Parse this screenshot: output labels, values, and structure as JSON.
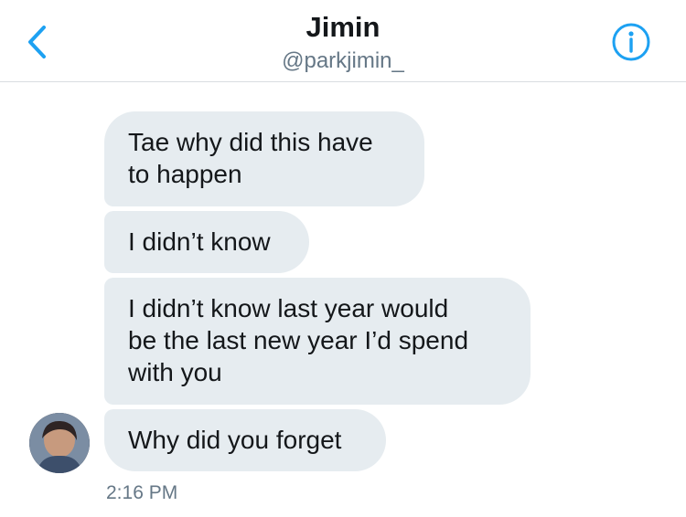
{
  "header": {
    "title": "Jimin",
    "handle": "@parkjimin_",
    "back_icon": "chevron-left-icon",
    "info_icon": "info-circle-icon",
    "accent": "#1da1f2"
  },
  "messages": [
    {
      "lines": [
        "Tae why did this have",
        "to happen"
      ]
    },
    {
      "lines": [
        "I didn’t know"
      ]
    },
    {
      "lines": [
        "I didn’t know last year would",
        "be the last new year I’d spend",
        "with you"
      ]
    },
    {
      "lines": [
        "Why did you forget"
      ]
    }
  ],
  "timestamp": "2:16 PM",
  "colors": {
    "bubble_bg": "#e6ecf0",
    "text": "#14171a",
    "secondary_text": "#657786",
    "divider": "#d9dde1"
  }
}
